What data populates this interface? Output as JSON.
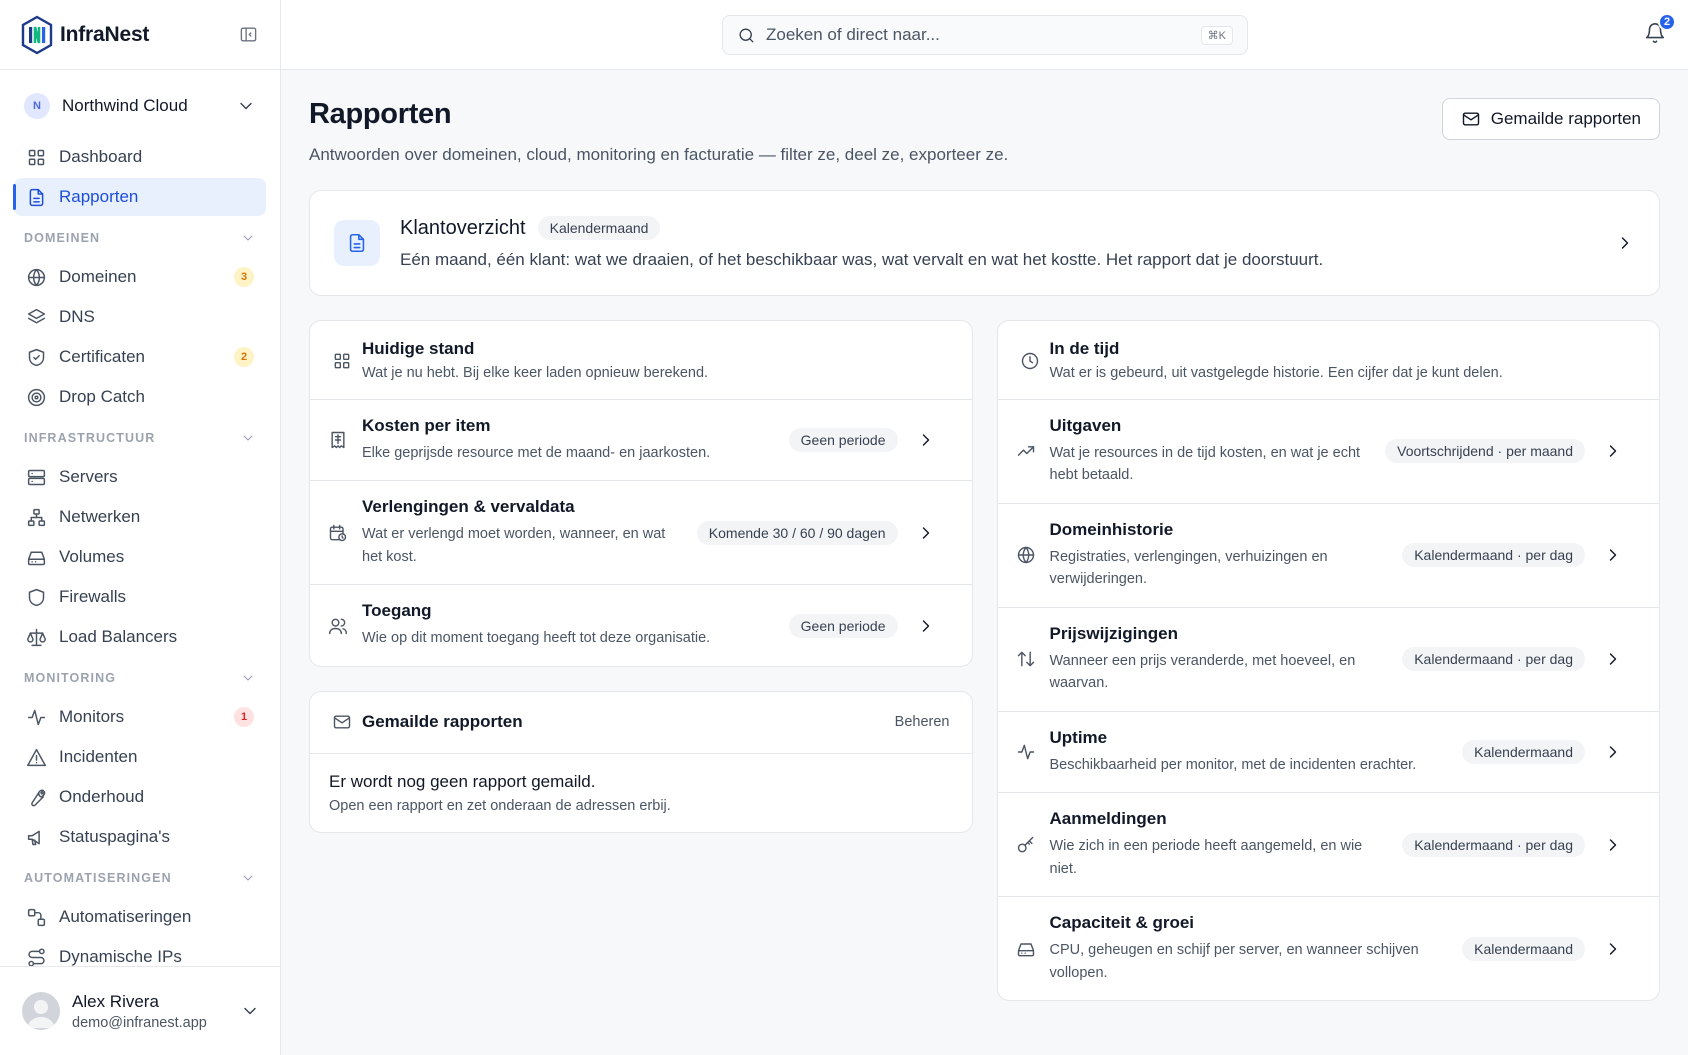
{
  "app": {
    "name": "InfraNest"
  },
  "org": {
    "initial": "N",
    "name": "Northwind Cloud"
  },
  "nav": {
    "top": [
      {
        "label": "Dashboard",
        "icon": "grid-icon"
      },
      {
        "label": "Rapporten",
        "icon": "file-text-icon",
        "active": true
      }
    ],
    "sections": [
      {
        "title": "DOMEINEN",
        "items": [
          {
            "label": "Domeinen",
            "icon": "globe-icon",
            "badge": "3",
            "badge_color": "amber"
          },
          {
            "label": "DNS",
            "icon": "layers-icon"
          },
          {
            "label": "Certificaten",
            "icon": "shield-check-icon",
            "badge": "2",
            "badge_color": "amber"
          },
          {
            "label": "Drop Catch",
            "icon": "target-icon"
          }
        ]
      },
      {
        "title": "INFRASTRUCTUUR",
        "items": [
          {
            "label": "Servers",
            "icon": "server-icon"
          },
          {
            "label": "Netwerken",
            "icon": "network-icon"
          },
          {
            "label": "Volumes",
            "icon": "hard-drive-icon"
          },
          {
            "label": "Firewalls",
            "icon": "shield-icon"
          },
          {
            "label": "Load Balancers",
            "icon": "scale-icon"
          }
        ]
      },
      {
        "title": "MONITORING",
        "items": [
          {
            "label": "Monitors",
            "icon": "activity-icon",
            "badge": "1",
            "badge_color": "red"
          },
          {
            "label": "Incidenten",
            "icon": "alert-triangle-icon"
          },
          {
            "label": "Onderhoud",
            "icon": "wrench-icon"
          },
          {
            "label": "Statuspagina's",
            "icon": "megaphone-icon"
          }
        ]
      },
      {
        "title": "AUTOMATISERINGEN",
        "items": [
          {
            "label": "Automatiseringen",
            "icon": "workflow-icon"
          },
          {
            "label": "Dynamische IPs",
            "icon": "route-icon"
          }
        ]
      }
    ]
  },
  "user": {
    "name": "Alex Rivera",
    "email": "demo@infranest.app"
  },
  "search": {
    "placeholder": "Zoeken of direct naar...",
    "shortcut": "⌘K"
  },
  "notifications": {
    "count": "2"
  },
  "page": {
    "title": "Rapporten",
    "subtitle": "Antwoorden over domeinen, cloud, monitoring en facturatie — filter ze, deel ze, exporteer ze.",
    "mailed_button": "Gemailde rapporten"
  },
  "hero": {
    "title": "Klantoverzicht",
    "badge": "Kalendermaand",
    "description": "Eén maand, één klant: wat we draaien, of het beschikbaar was, wat vervalt en wat het kostte. Het rapport dat je doorstuurt."
  },
  "current": {
    "title": "Huidige stand",
    "description": "Wat je nu hebt. Bij elke keer laden opnieuw berekend.",
    "rows": [
      {
        "title": "Kosten per item",
        "description": "Elke geprijsde resource met de maand- en jaarkosten.",
        "period": "Geen periode",
        "icon": "receipt-icon"
      },
      {
        "title": "Verlengingen & vervaldata",
        "description": "Wat er verlengd moet worden, wanneer, en wat het kost.",
        "period": "Komende 30 / 60 / 90 dagen",
        "icon": "calendar-clock-icon"
      },
      {
        "title": "Toegang",
        "description": "Wie op dit moment toegang heeft tot deze organisatie.",
        "period": "Geen periode",
        "icon": "users-icon"
      }
    ]
  },
  "mailed": {
    "title": "Gemailde rapporten",
    "manage": "Beheren",
    "empty": "Er wordt nog geen rapport gemaild.",
    "hint": "Open een rapport en zet onderaan de adressen erbij."
  },
  "history": {
    "title": "In de tijd",
    "description": "Wat er is gebeurd, uit vastgelegde historie. Een cijfer dat je kunt delen.",
    "rows": [
      {
        "title": "Uitgaven",
        "description": "Wat je resources in de tijd kosten, en wat je echt hebt betaald.",
        "period": "Voortschrijdend · per maand",
        "icon": "trending-up-icon"
      },
      {
        "title": "Domeinhistorie",
        "description": "Registraties, verlengingen, verhuizingen en verwijderingen.",
        "period": "Kalendermaand · per dag",
        "icon": "globe-icon"
      },
      {
        "title": "Prijswijzigingen",
        "description": "Wanneer een prijs veranderde, met hoeveel, en waarvan.",
        "period": "Kalendermaand · per dag",
        "icon": "arrow-up-down-icon"
      },
      {
        "title": "Uptime",
        "description": "Beschikbaarheid per monitor, met de incidenten erachter.",
        "period": "Kalendermaand",
        "icon": "activity-icon"
      },
      {
        "title": "Aanmeldingen",
        "description": "Wie zich in een periode heeft aangemeld, en wie niet.",
        "period": "Kalendermaand · per dag",
        "icon": "key-icon"
      },
      {
        "title": "Capaciteit & groei",
        "description": "CPU, geheugen en schijf per server, en wanneer schijven vollopen.",
        "period": "Kalendermaand",
        "icon": "hard-drive-icon"
      }
    ]
  }
}
